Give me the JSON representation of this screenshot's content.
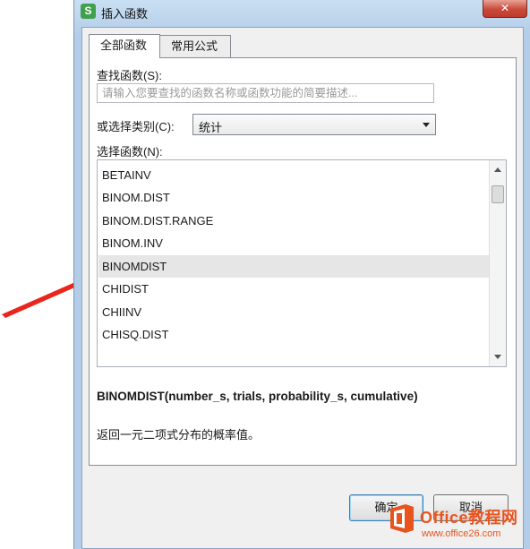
{
  "window": {
    "app_icon": "S",
    "title": "插入函数",
    "close_glyph": "✕"
  },
  "tabs": [
    {
      "label": "全部函数",
      "active": true
    },
    {
      "label": "常用公式",
      "active": false
    }
  ],
  "search": {
    "label": "查找函数(S):",
    "placeholder": "请输入您要查找的函数名称或函数功能的简要描述..."
  },
  "category": {
    "label": "或选择类别(C):",
    "value": "统计"
  },
  "function_list": {
    "label": "选择函数(N):",
    "items": [
      "BETAINV",
      "BINOM.DIST",
      "BINOM.DIST.RANGE",
      "BINOM.INV",
      "BINOMDIST",
      "CHIDIST",
      "CHIINV",
      "CHISQ.DIST"
    ],
    "selected_index": 4
  },
  "syntax": "BINOMDIST(number_s, trials, probability_s, cumulative)",
  "description": "返回一元二项式分布的概率值。",
  "buttons": {
    "ok": "确定",
    "cancel": "取消"
  },
  "watermark": {
    "name": "Office教程网",
    "url": "www.office26.com"
  },
  "colors": {
    "arrow": "#e8261d",
    "watermark": "#e8541e"
  }
}
